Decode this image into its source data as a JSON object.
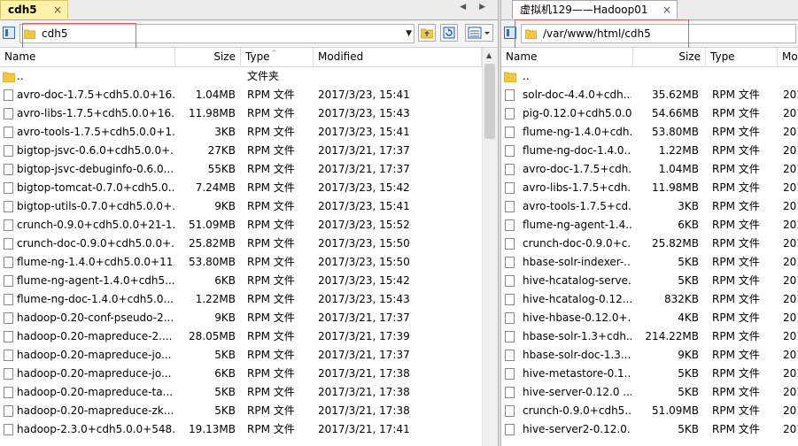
{
  "left": {
    "tab_label": "cdh5",
    "tab_close": "×",
    "nav_arrows": "◀ ▶",
    "path": "cdh5",
    "columns": {
      "name": "Name",
      "size": "Size",
      "type": "Type",
      "modified": "Modified"
    },
    "rows": [
      {
        "name": "..",
        "size": "",
        "type": "文件夹",
        "modified": "",
        "kind": "folder"
      },
      {
        "name": "avro-doc-1.7.5+cdh5.0.0+16...",
        "size": "1.04MB",
        "type": "RPM 文件",
        "modified": "2017/3/23, 15:41",
        "kind": "file"
      },
      {
        "name": "avro-libs-1.7.5+cdh5.0.0+16...",
        "size": "11.98MB",
        "type": "RPM 文件",
        "modified": "2017/3/23, 15:43",
        "kind": "file"
      },
      {
        "name": "avro-tools-1.7.5+cdh5.0.0+1...",
        "size": "3KB",
        "type": "RPM 文件",
        "modified": "2017/3/23, 15:41",
        "kind": "file"
      },
      {
        "name": "bigtop-jsvc-0.6.0+cdh5.0.0+...",
        "size": "27KB",
        "type": "RPM 文件",
        "modified": "2017/3/21, 17:37",
        "kind": "file"
      },
      {
        "name": "bigtop-jsvc-debuginfo-0.6.0...",
        "size": "55KB",
        "type": "RPM 文件",
        "modified": "2017/3/21, 17:37",
        "kind": "file"
      },
      {
        "name": "bigtop-tomcat-0.7.0+cdh5.0...",
        "size": "7.24MB",
        "type": "RPM 文件",
        "modified": "2017/3/23, 15:42",
        "kind": "file"
      },
      {
        "name": "bigtop-utils-0.7.0+cdh5.0.0+...",
        "size": "9KB",
        "type": "RPM 文件",
        "modified": "2017/3/23, 15:41",
        "kind": "file"
      },
      {
        "name": "crunch-0.9.0+cdh5.0.0+21-1...",
        "size": "51.09MB",
        "type": "RPM 文件",
        "modified": "2017/3/23, 15:52",
        "kind": "file"
      },
      {
        "name": "crunch-doc-0.9.0+cdh5.0.0+...",
        "size": "25.82MB",
        "type": "RPM 文件",
        "modified": "2017/3/23, 15:50",
        "kind": "file"
      },
      {
        "name": "flume-ng-1.4.0+cdh5.0.0+11...",
        "size": "53.80MB",
        "type": "RPM 文件",
        "modified": "2017/3/23, 15:50",
        "kind": "file"
      },
      {
        "name": "flume-ng-agent-1.4.0+cdh5....",
        "size": "6KB",
        "type": "RPM 文件",
        "modified": "2017/3/23, 15:42",
        "kind": "file"
      },
      {
        "name": "flume-ng-doc-1.4.0+cdh5.0....",
        "size": "1.22MB",
        "type": "RPM 文件",
        "modified": "2017/3/23, 15:43",
        "kind": "file"
      },
      {
        "name": "hadoop-0.20-conf-pseudo-2....",
        "size": "9KB",
        "type": "RPM 文件",
        "modified": "2017/3/21, 17:37",
        "kind": "file"
      },
      {
        "name": "hadoop-0.20-mapreduce-2....",
        "size": "28.05MB",
        "type": "RPM 文件",
        "modified": "2017/3/21, 17:39",
        "kind": "file"
      },
      {
        "name": "hadoop-0.20-mapreduce-jo...",
        "size": "5KB",
        "type": "RPM 文件",
        "modified": "2017/3/21, 17:37",
        "kind": "file"
      },
      {
        "name": "hadoop-0.20-mapreduce-jo...",
        "size": "6KB",
        "type": "RPM 文件",
        "modified": "2017/3/21, 17:38",
        "kind": "file"
      },
      {
        "name": "hadoop-0.20-mapreduce-ta...",
        "size": "5KB",
        "type": "RPM 文件",
        "modified": "2017/3/21, 17:38",
        "kind": "file"
      },
      {
        "name": "hadoop-0.20-mapreduce-zk...",
        "size": "5KB",
        "type": "RPM 文件",
        "modified": "2017/3/21, 17:38",
        "kind": "file"
      },
      {
        "name": "hadoop-2.3.0+cdh5.0.0+548...",
        "size": "19.13MB",
        "type": "RPM 文件",
        "modified": "2017/3/21, 17:41",
        "kind": "file"
      }
    ]
  },
  "right": {
    "tab_label": "虚拟机129——Hadoop01",
    "tab_close": "×",
    "path": "/var/www/html/cdh5",
    "columns": {
      "name": "Name",
      "size": "Size",
      "type": "Type",
      "modified": "Mo"
    },
    "rows": [
      {
        "name": "..",
        "size": "",
        "type": "",
        "modified": "",
        "kind": "folder"
      },
      {
        "name": "solr-doc-4.4.0+cdh...",
        "size": "35.62MB",
        "type": "RPM 文件",
        "modified": "201",
        "kind": "file"
      },
      {
        "name": "pig-0.12.0+cdh5.0.0...",
        "size": "54.66MB",
        "type": "RPM 文件",
        "modified": "201",
        "kind": "file"
      },
      {
        "name": "flume-ng-1.4.0+cdh...",
        "size": "53.80MB",
        "type": "RPM 文件",
        "modified": "201",
        "kind": "file"
      },
      {
        "name": "flume-ng-doc-1.4.0...",
        "size": "1.22MB",
        "type": "RPM 文件",
        "modified": "201",
        "kind": "file"
      },
      {
        "name": "avro-doc-1.7.5+cdh...",
        "size": "1.04MB",
        "type": "RPM 文件",
        "modified": "201",
        "kind": "file"
      },
      {
        "name": "avro-libs-1.7.5+cdh...",
        "size": "11.98MB",
        "type": "RPM 文件",
        "modified": "201",
        "kind": "file"
      },
      {
        "name": "avro-tools-1.7.5+cd...",
        "size": "3KB",
        "type": "RPM 文件",
        "modified": "201",
        "kind": "file"
      },
      {
        "name": "flume-ng-agent-1.4....",
        "size": "6KB",
        "type": "RPM 文件",
        "modified": "201",
        "kind": "file"
      },
      {
        "name": "crunch-doc-0.9.0+c...",
        "size": "25.82MB",
        "type": "RPM 文件",
        "modified": "201",
        "kind": "file"
      },
      {
        "name": "hbase-solr-indexer-...",
        "size": "5KB",
        "type": "RPM 文件",
        "modified": "201",
        "kind": "file"
      },
      {
        "name": "hive-hcatalog-serve...",
        "size": "5KB",
        "type": "RPM 文件",
        "modified": "201",
        "kind": "file"
      },
      {
        "name": "hive-hcatalog-0.12....",
        "size": "832KB",
        "type": "RPM 文件",
        "modified": "201",
        "kind": "file"
      },
      {
        "name": "hive-hbase-0.12.0+...",
        "size": "4KB",
        "type": "RPM 文件",
        "modified": "201",
        "kind": "file"
      },
      {
        "name": "hbase-solr-1.3+cdh...",
        "size": "214.22MB",
        "type": "RPM 文件",
        "modified": "201",
        "kind": "file"
      },
      {
        "name": "hbase-solr-doc-1.3....",
        "size": "9KB",
        "type": "RPM 文件",
        "modified": "201",
        "kind": "file"
      },
      {
        "name": "hive-metastore-0.1...",
        "size": "5KB",
        "type": "RPM 文件",
        "modified": "201",
        "kind": "file"
      },
      {
        "name": "hive-server-0.12.0 ...",
        "size": "5KB",
        "type": "RPM 文件",
        "modified": "201",
        "kind": "file"
      },
      {
        "name": "crunch-0.9.0+cdh5....",
        "size": "51.09MB",
        "type": "RPM 文件",
        "modified": "201",
        "kind": "file"
      },
      {
        "name": "hive-server2-0.12.0...",
        "size": "5KB",
        "type": "RPM 文件",
        "modified": "201",
        "kind": "file"
      }
    ]
  },
  "colors": {
    "tab_active": "#fdf2a8",
    "highlight_box": "#e06060",
    "folder": "#f2c744"
  }
}
